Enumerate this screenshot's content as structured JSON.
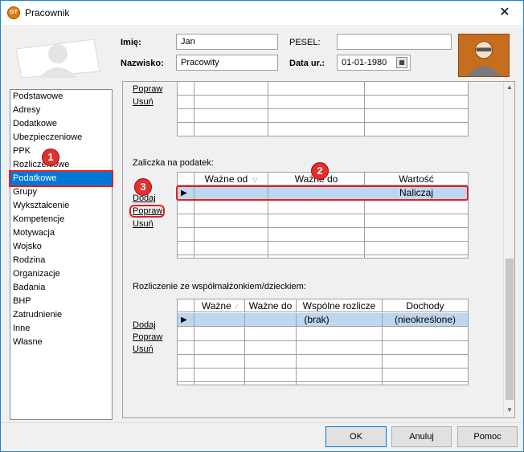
{
  "window": {
    "title": "Pracownik",
    "icon": "app-logo-icon",
    "close": "✕"
  },
  "header": {
    "first_name_label": "Imię:",
    "first_name_value": "Jan",
    "last_name_label": "Nazwisko:",
    "last_name_value": "Pracowity",
    "pesel_label": "PESEL:",
    "pesel_value": "",
    "birth_date_label": "Data ur.:",
    "birth_date_value": "01-01-1980"
  },
  "sidebar": {
    "items": [
      {
        "label": "Podstawowe"
      },
      {
        "label": "Adresy"
      },
      {
        "label": "Dodatkowe"
      },
      {
        "label": "Ubezpieczeniowe"
      },
      {
        "label": "PPK"
      },
      {
        "label": "Rozliczeniowe"
      },
      {
        "label": "Podatkowe"
      },
      {
        "label": "Grupy"
      },
      {
        "label": "Wykształcenie"
      },
      {
        "label": "Kompetencje"
      },
      {
        "label": "Motywacja"
      },
      {
        "label": "Wojsko"
      },
      {
        "label": "Rodzina"
      },
      {
        "label": "Organizacje"
      },
      {
        "label": "Badania"
      },
      {
        "label": "BHP"
      },
      {
        "label": "Zatrudnienie"
      },
      {
        "label": "Inne"
      },
      {
        "label": "Własne"
      }
    ],
    "selected": "Podatkowe"
  },
  "top_section": {
    "links": [
      "Popraw",
      "Usuń"
    ]
  },
  "tax_section": {
    "label": "Zaliczka na podatek:",
    "links": [
      "Dodaj",
      "Popraw",
      "Usuń"
    ],
    "columns": [
      "Ważne od",
      "Ważne do",
      "Wartość"
    ],
    "rows": [
      {
        "valid_from": "",
        "valid_to": "",
        "value": "Naliczaj"
      }
    ]
  },
  "spouse_section": {
    "label": "Rozliczenie ze współmałżonkiem/dzieckiem:",
    "links": [
      "Dodaj",
      "Popraw",
      "Usuń"
    ],
    "columns": [
      "Ważne",
      "Ważne do",
      "Wspólne rozlicze",
      "Dochody"
    ],
    "rows": [
      {
        "valid_from": "",
        "valid_to": "",
        "joint": "(brak)",
        "income": "(nieokreślone)"
      }
    ]
  },
  "annotations": [
    "1",
    "2",
    "3"
  ],
  "footer": {
    "ok": "OK",
    "cancel": "Anuluj",
    "help": "Pomoc"
  },
  "colors": {
    "selection": "#0078d7",
    "row_selected": "#bdd7ee",
    "annotation_red": "#e02020",
    "avatar_orange": "#c66e1e"
  }
}
